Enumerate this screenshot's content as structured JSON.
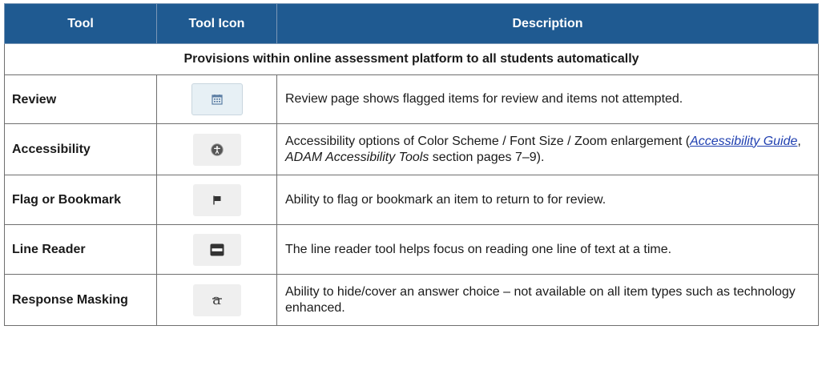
{
  "header": {
    "col_tool": "Tool",
    "col_icon": "Tool Icon",
    "col_desc": "Description"
  },
  "section_heading": "Provisions within online assessment platform to all students automatically",
  "rows": [
    {
      "tool": "Review",
      "icon": "calendar-icon",
      "description": "Review page shows flagged items for review and items not attempted."
    },
    {
      "tool": "Accessibility",
      "icon": "accessibility-icon",
      "description_part1": "Accessibility options of Color Scheme / Font Size / Zoom enlargement (",
      "description_link": "Accessibility Guide",
      "description_part2": ", ",
      "description_italic": "ADAM Accessibility Tools",
      "description_part3": " section pages 7–9)."
    },
    {
      "tool": "Flag or Bookmark",
      "icon": "flag-icon",
      "description": "Ability to flag or bookmark an item to return to for review."
    },
    {
      "tool": "Line Reader",
      "icon": "line-reader-icon",
      "description": "The line reader tool helps focus on reading one line of text at a time."
    },
    {
      "tool": "Response Masking",
      "icon": "response-masking-icon",
      "icon_glyph": "a",
      "description": "Ability to hide/cover an answer choice – not available on all item types such as technology enhanced."
    }
  ],
  "colors": {
    "header_bg": "#1f5a91",
    "header_text": "#ffffff",
    "link": "#1f3fb0",
    "border": "#6f6f6f"
  }
}
